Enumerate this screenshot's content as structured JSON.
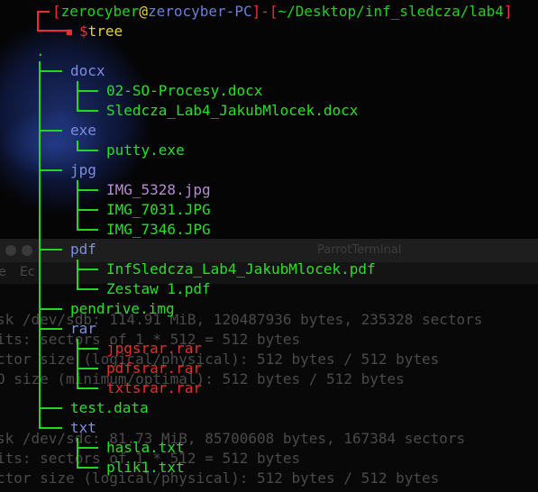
{
  "prompt": {
    "user": "zerocyber",
    "at": "@",
    "host": "zerocyber-PC",
    "path": "~/Desktop/inf_sledcza/lab4",
    "command": "$tree"
  },
  "tree": {
    "root": ".",
    "dirs": [
      {
        "name": "docx",
        "files": [
          "02-SO-Procesy.docx",
          "Sledcza_Lab4_JakubMlocek.docx"
        ]
      },
      {
        "name": "exe",
        "files": [
          "putty.exe"
        ]
      },
      {
        "name": "jpg",
        "files": [
          "IMG_5328.jpg",
          "IMG_7031.JPG",
          "IMG_7346.JPG"
        ]
      },
      {
        "name": "pdf",
        "files": [
          "InfSledcza_Lab4_JakubMlocek.pdf",
          "Zestaw 1.pdf"
        ]
      },
      {
        "name": "pendrive.img",
        "files": []
      },
      {
        "name": "rar",
        "files": [
          "jpgsrar.rar",
          "pdfsrar.rar",
          "txtsrar.rar"
        ]
      },
      {
        "name": "test.data",
        "files": []
      },
      {
        "name": "txt",
        "files": [
          "hasla.txt",
          "plik1.txt"
        ]
      }
    ]
  },
  "behind_window": {
    "title": "ParrotTerminal",
    "menu": [
      "e",
      "Ec"
    ],
    "lines": [
      "sk /dev/sdb: 114.91 MiB, 120487936 bytes, 235328 sectors",
      "its: sectors of 1 * 512 = 512 bytes",
      "ctor size (logical/physical): 512 bytes / 512 bytes",
      "O size (minimum/optimal): 512 bytes / 512 bytes",
      "sk /dev/sdc: 81.73 MiB, 85700608 bytes, 167384 sectors",
      "its: sectors of 1 * 512 = 512 bytes",
      "ctor size (logical/physical): 512 bytes / 512 bytes"
    ]
  }
}
